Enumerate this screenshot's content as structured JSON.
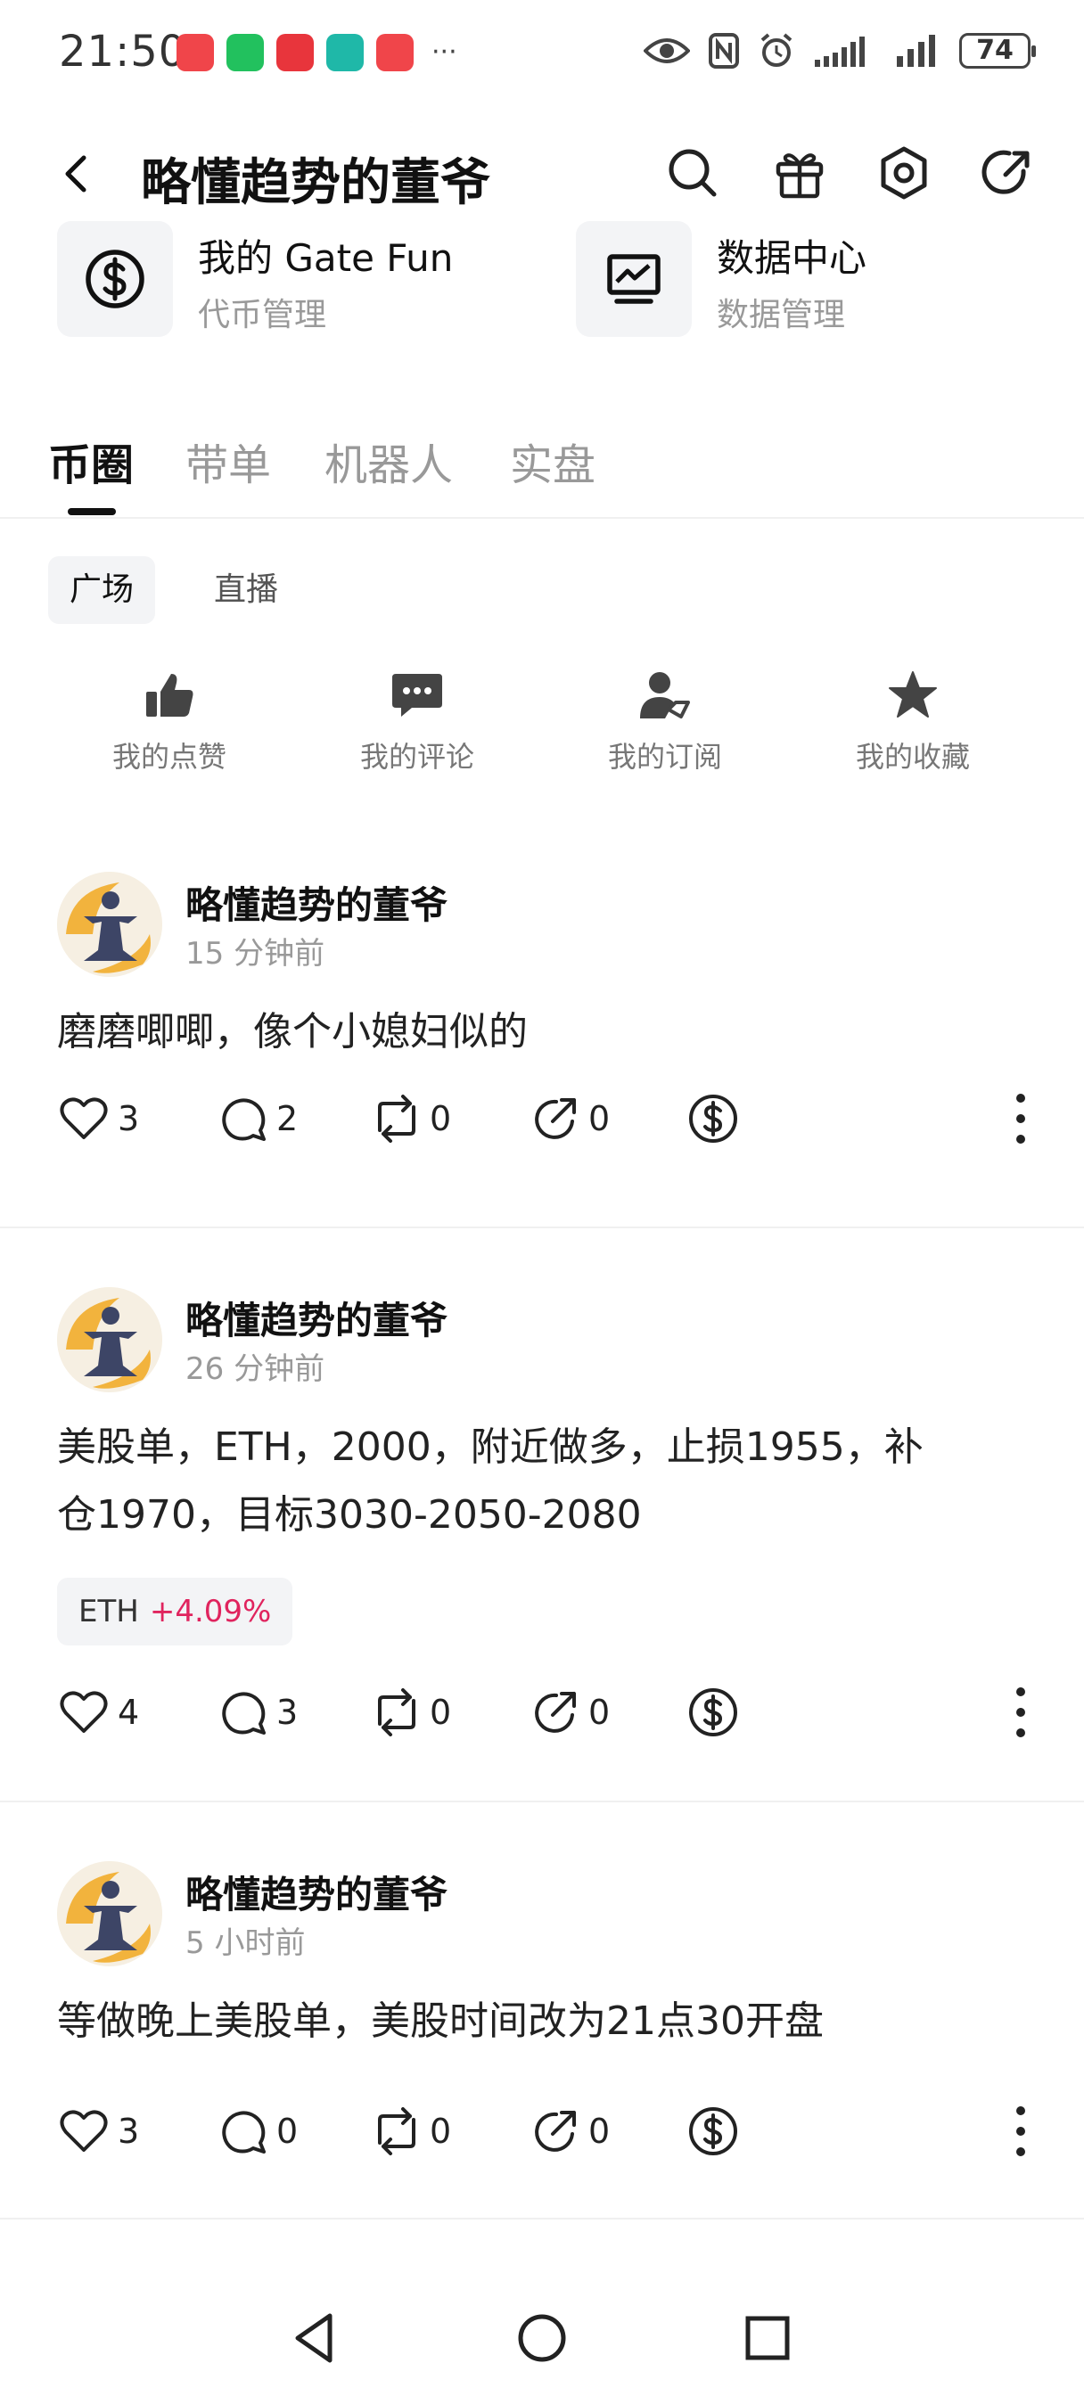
{
  "status_bar": {
    "time": "21:50",
    "battery": "74",
    "more_dots": "···",
    "app_icon_colors": [
      "#f0454a",
      "#22c15e",
      "#e8353c",
      "#1fb8a8",
      "#f0454a"
    ]
  },
  "header": {
    "title": "略懂趋势的董爷"
  },
  "features": [
    {
      "title": "我的 Gate Fun",
      "subtitle": "代币管理",
      "icon": "dollar-coin-icon"
    },
    {
      "title": "数据中心",
      "subtitle": "数据管理",
      "icon": "chart-monitor-icon"
    }
  ],
  "tabs": [
    {
      "label": "币圈",
      "active": true
    },
    {
      "label": "带单",
      "active": false
    },
    {
      "label": "机器人",
      "active": false
    },
    {
      "label": "实盘",
      "active": false
    }
  ],
  "subtabs": [
    {
      "label": "广场",
      "active": true
    },
    {
      "label": "直播",
      "active": false
    }
  ],
  "quick_actions": [
    {
      "label": "我的点赞",
      "icon": "thumbs-up-icon"
    },
    {
      "label": "我的评论",
      "icon": "comment-bubble-icon"
    },
    {
      "label": "我的订阅",
      "icon": "user-check-icon"
    },
    {
      "label": "我的收藏",
      "icon": "star-icon"
    }
  ],
  "posts": [
    {
      "author": "略懂趋势的董爷",
      "time": "15 分钟前",
      "text_lines": [
        "磨磨唧唧，像个小媳妇似的"
      ],
      "likes": "3",
      "comments": "2",
      "reposts": "0",
      "shares": "0"
    },
    {
      "author": "略懂趋势的董爷",
      "time": "26 分钟前",
      "text_lines": [
        "美股单，ETH，2000，附近做多，止损1955，补",
        "仓1970，目标3030-2050-2080"
      ],
      "tag": {
        "symbol": "ETH",
        "change": "+4.09%"
      },
      "likes": "4",
      "comments": "3",
      "reposts": "0",
      "shares": "0"
    },
    {
      "author": "略懂趋势的董爷",
      "time": "5 小时前",
      "text_lines": [
        "等做晚上美股单，美股时间改为21点30开盘"
      ],
      "likes": "3",
      "comments": "0",
      "reposts": "0",
      "shares": "0"
    }
  ],
  "colors": {
    "accent_negative": "#e0245e",
    "avatar_gold": "#f2b33d",
    "avatar_figure": "#3d4566"
  }
}
